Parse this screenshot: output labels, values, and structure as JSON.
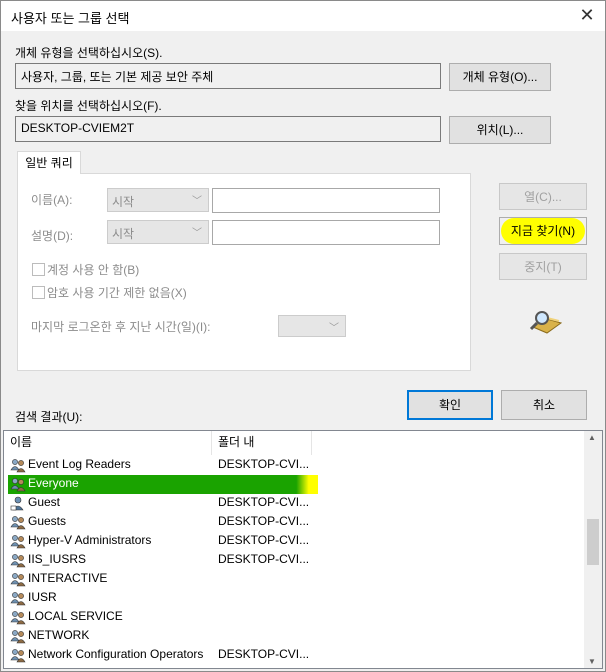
{
  "window": {
    "title": "사용자 또는 그룹 선택",
    "close_glyph": "✕"
  },
  "object_type": {
    "label": "개체 유형을 선택하십시오(S).",
    "value": "사용자, 그룹, 또는 기본 제공 보안 주체",
    "button": "개체 유형(O)..."
  },
  "location": {
    "label": "찾을 위치를 선택하십시오(F).",
    "value": "DESKTOP-CVIEM2T",
    "button": "위치(L)..."
  },
  "query": {
    "tab_label": "일반 쿼리",
    "name_label": "이름(A):",
    "name_mode": "시작",
    "desc_label": "설명(D):",
    "desc_mode": "시작",
    "disabled_accounts_label": "계정 사용 안 함(B)",
    "non_expiring_pw_label": "암호 사용 기간 제한 없음(X)",
    "days_since_logon_label": "마지막 로그온한 후 지난 시간(일)(I):"
  },
  "side_buttons": {
    "columns": "열(C)...",
    "find_now": "지금 찾기(N)",
    "stop": "중지(T)"
  },
  "ok_label": "확인",
  "cancel_label": "취소",
  "results": {
    "label": "검색 결과(U):",
    "columns": [
      "이름",
      "폴더 내"
    ],
    "rows": [
      {
        "name": "Event Log Readers",
        "folder": "DESKTOP-CVI...",
        "icon": "group-icon"
      },
      {
        "name": "Everyone",
        "folder": "",
        "icon": "group-icon",
        "selected": true
      },
      {
        "name": "Guest",
        "folder": "DESKTOP-CVI...",
        "icon": "user-icon"
      },
      {
        "name": "Guests",
        "folder": "DESKTOP-CVI...",
        "icon": "group-icon"
      },
      {
        "name": "Hyper-V Administrators",
        "folder": "DESKTOP-CVI...",
        "icon": "group-icon"
      },
      {
        "name": "IIS_IUSRS",
        "folder": "DESKTOP-CVI...",
        "icon": "group-icon"
      },
      {
        "name": "INTERACTIVE",
        "folder": "",
        "icon": "group-icon"
      },
      {
        "name": "IUSR",
        "folder": "",
        "icon": "group-icon"
      },
      {
        "name": "LOCAL SERVICE",
        "folder": "",
        "icon": "group-icon"
      },
      {
        "name": "NETWORK",
        "folder": "",
        "icon": "group-icon"
      },
      {
        "name": "Network Configuration Operators",
        "folder": "DESKTOP-CVI...",
        "icon": "group-icon"
      }
    ]
  },
  "colors": {
    "selection_green": "#1aa300",
    "highlight_yellow": "#ffff00",
    "default_button_border": "#0078d7"
  }
}
